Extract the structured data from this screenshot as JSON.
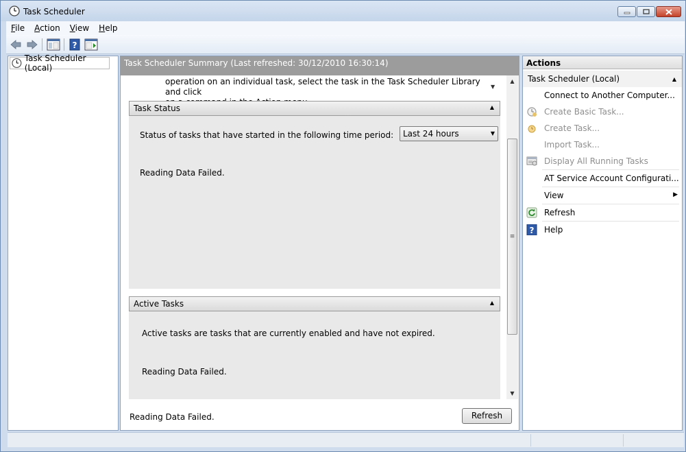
{
  "window": {
    "title": "Task Scheduler"
  },
  "menubar": {
    "items": [
      {
        "label": "File",
        "key": "F",
        "rest": "ile"
      },
      {
        "label": "Action",
        "key": "A",
        "rest": "ction"
      },
      {
        "label": "View",
        "key": "V",
        "rest": "iew"
      },
      {
        "label": "Help",
        "key": "H",
        "rest": "elp"
      }
    ]
  },
  "toolbar": {
    "icons": [
      "back-arrow-icon",
      "forward-arrow-icon",
      "show-hide-console-tree-icon",
      "help-icon",
      "show-hide-action-pane-icon"
    ]
  },
  "tree": {
    "root_label": "Task Scheduler (Local)"
  },
  "center": {
    "header": "Task Scheduler Summary (Last refreshed: 30/12/2010 16:30:14)",
    "intro_line1": "operation on an individual task, select the task in the Task Scheduler Library and click",
    "intro_line2": "on a command in the Action menu.",
    "task_status": {
      "title": "Task Status",
      "period_label": "Status of tasks that have started in the following time period:",
      "period_value": "Last 24 hours",
      "message": "Reading Data Failed."
    },
    "active_tasks": {
      "title": "Active Tasks",
      "description": "Active tasks are tasks that are currently enabled and have not expired.",
      "message": "Reading Data Failed."
    },
    "footer": {
      "message": "Reading Data Failed.",
      "refresh_label": "Refresh"
    }
  },
  "actions": {
    "header": "Actions",
    "subheader": "Task Scheduler (Local)",
    "items": [
      {
        "label": "Connect to Another Computer...",
        "enabled": true,
        "icon": ""
      },
      {
        "label": "Create Basic Task...",
        "enabled": false,
        "icon": "create-basic-task-icon"
      },
      {
        "label": "Create Task...",
        "enabled": false,
        "icon": "create-task-icon"
      },
      {
        "label": "Import Task...",
        "enabled": false,
        "icon": ""
      },
      {
        "label": "Display All Running Tasks",
        "enabled": false,
        "icon": "running-tasks-icon"
      },
      {
        "label": "AT Service Account Configurati...",
        "enabled": true,
        "icon": ""
      },
      {
        "label": "View",
        "enabled": true,
        "icon": "",
        "submenu": true
      },
      {
        "label": "Refresh",
        "enabled": true,
        "icon": "refresh-icon"
      },
      {
        "label": "Help",
        "enabled": true,
        "icon": "help-icon"
      }
    ]
  }
}
